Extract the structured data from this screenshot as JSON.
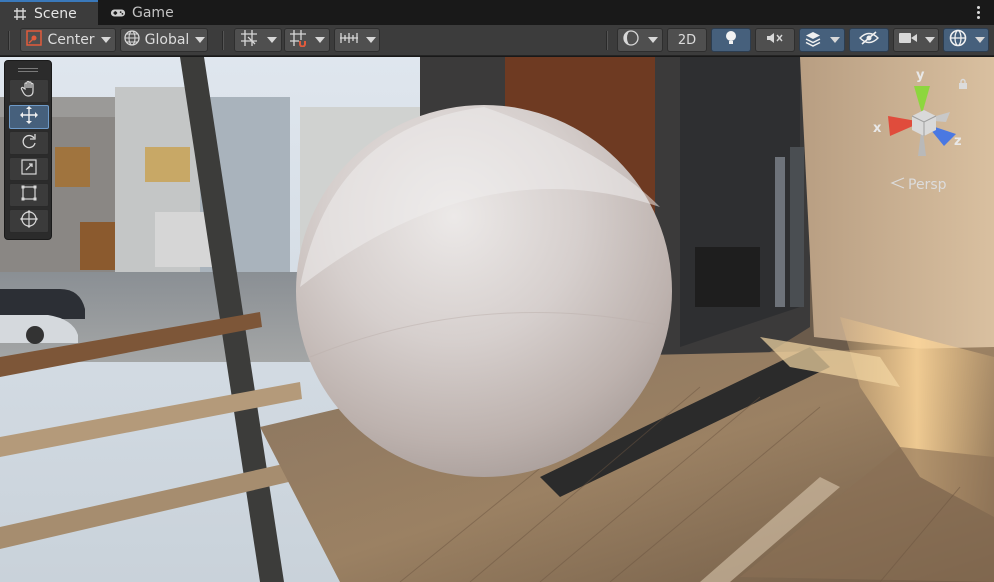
{
  "tabs": [
    {
      "label": "Scene",
      "icon": "grid-icon",
      "active": true
    },
    {
      "label": "Game",
      "icon": "gamepad-icon",
      "active": false
    }
  ],
  "toolbar": {
    "pivot_mode": "Center",
    "pivot_rotation": "Global",
    "view_2d_label": "2D"
  },
  "gizmo": {
    "y_label": "y",
    "x_label": "x",
    "z_label": "z",
    "projection_label": "Persp"
  },
  "tools": [
    "hand-tool",
    "move-tool",
    "rotate-tool",
    "scale-tool",
    "rect-tool",
    "transform-tool"
  ],
  "selected_tool": "move-tool",
  "colors": {
    "accent_blue": "#46607c",
    "tab_highlight": "#3a79bb",
    "toolbar_bg": "#3c3c3c",
    "axis_x": "#e04c3c",
    "axis_y": "#8dd63e",
    "axis_z": "#4a78e2"
  }
}
